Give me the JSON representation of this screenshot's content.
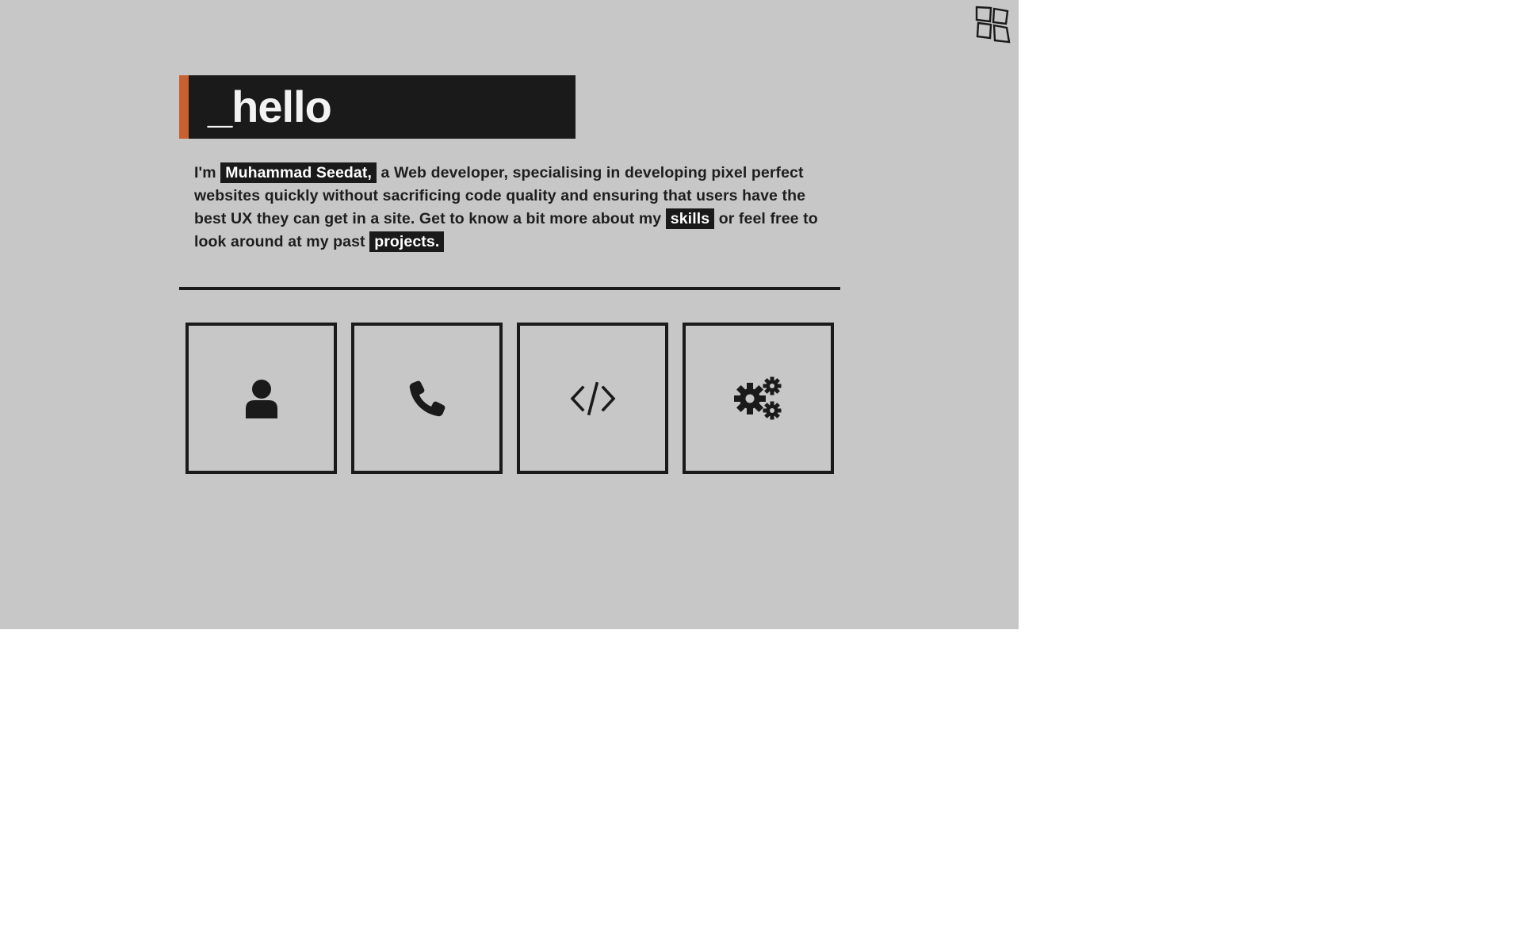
{
  "header": {
    "menu_icon": "windows-grid-icon"
  },
  "hero": {
    "title": "_hello",
    "accent_color": "#c8612f"
  },
  "intro": {
    "prefix": "I'm",
    "name": "Muhammad Seedat,",
    "middle": "a Web developer, specialising in developing pixel perfect websites quickly without sacrificing code quality and ensuring that users have the best UX they can get in a site. Get to know a bit more about my",
    "skills_link": "skills",
    "between": "or feel free to look around at my past",
    "projects_link": "projects."
  },
  "tiles": [
    {
      "icon": "user-icon"
    },
    {
      "icon": "phone-icon"
    },
    {
      "icon": "code-icon"
    },
    {
      "icon": "gears-icon"
    }
  ],
  "colors": {
    "background": "#c7c7c7",
    "dark": "#1a1a1a",
    "text": "#1e1e1e"
  }
}
